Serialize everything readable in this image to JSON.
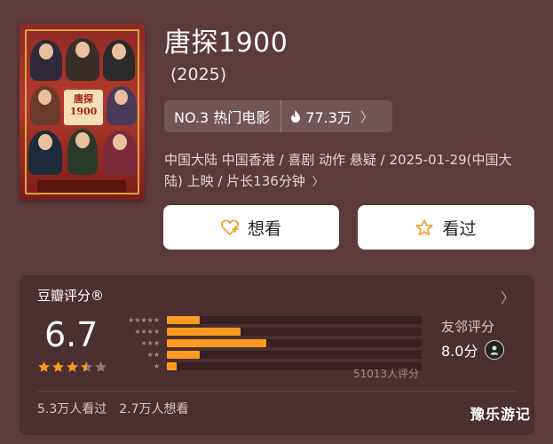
{
  "movie": {
    "title": "唐探1900",
    "year": "(2025)",
    "rank": "NO.3 热门电影",
    "heat": "77.3万",
    "info": "中国大陆 中国香港 / 喜剧 动作 悬疑 / 2025-01-29(中国大陆) 上映 / 片长136分钟",
    "poster_text": "唐探 1900"
  },
  "actions": {
    "want_label": "想看",
    "seen_label": "看过"
  },
  "rating": {
    "header": "豆瓣评分®",
    "score": "6.7",
    "stars": 3.5,
    "distribution": [
      {
        "stars": 5,
        "fraction": 0.13
      },
      {
        "stars": 4,
        "fraction": 0.29
      },
      {
        "stars": 3,
        "fraction": 0.39
      },
      {
        "stars": 2,
        "fraction": 0.13
      },
      {
        "stars": 1,
        "fraction": 0.04
      }
    ],
    "count": "51013人评分",
    "friend_label": "友邻评分",
    "friend_score": "8.0分",
    "watched": "5.3万人看过",
    "wanted": "2.7万人想看"
  },
  "watermark": "豫乐游记",
  "colors": {
    "accent": "#ff9a1e",
    "background": "#5d3a3c",
    "card": "#4b2f31"
  }
}
